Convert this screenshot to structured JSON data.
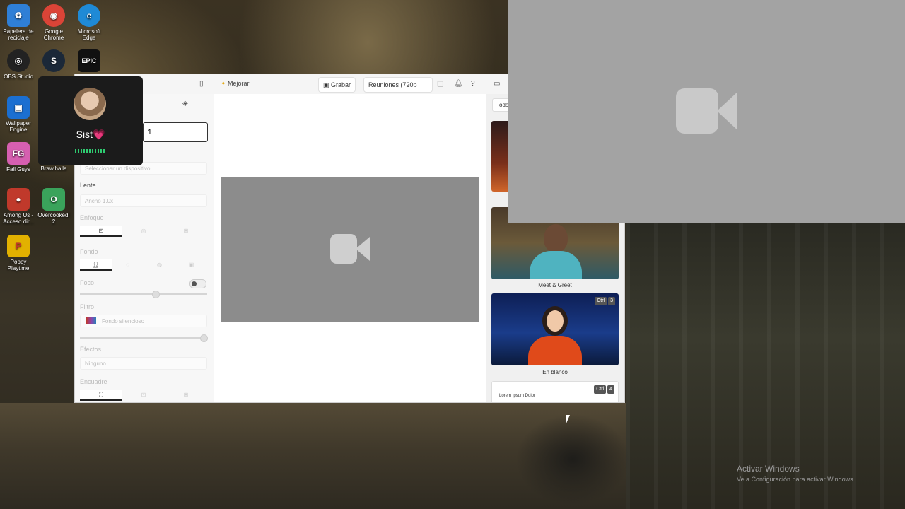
{
  "desktop": {
    "icons": [
      {
        "label": "Papelera de reciclaje",
        "glyph": "♻",
        "color": "#2f7fd6"
      },
      {
        "label": "Google Chrome",
        "glyph": "◉",
        "color": "#db4437"
      },
      {
        "label": "Microsoft Edge",
        "glyph": "e",
        "color": "#1f8ad6"
      },
      {
        "label": "OBS Studio",
        "glyph": "◎",
        "color": "#222222"
      },
      {
        "label": "",
        "glyph": "S",
        "color": "#1b2838"
      },
      {
        "label": "",
        "glyph": "EPIC",
        "color": "#111111"
      },
      {
        "label": "Wallpaper Engine",
        "glyph": "▣",
        "color": "#1b6fd1"
      },
      {
        "label": "Fall Guys",
        "glyph": "FG",
        "color": "#d65fb0"
      },
      {
        "label": "Brawlhalla",
        "glyph": "B",
        "color": "#4a6aa8"
      },
      {
        "label": "Among Us - Acceso dir...",
        "glyph": "●",
        "color": "#c0392b"
      },
      {
        "label": "Overcooked! 2",
        "glyph": "O",
        "color": "#3aa35b"
      },
      {
        "label": "Poppy Playtime",
        "glyph": "P",
        "color": "#e2b100"
      }
    ]
  },
  "profile": {
    "name": "Sist💗"
  },
  "app": {
    "toolbar": {
      "mejorar": "Mejorar",
      "grabar": "Grabar",
      "reuniones": "Reuniones (720p"
    },
    "left_panel": {
      "name_value": "1",
      "device_placeholder": "Seleccionar un dispositivo...",
      "lente_label": "Lente",
      "lente_value": "Ancho 1.0x",
      "enfoque_label": "Enfoque",
      "fondo_label": "Fondo",
      "foco_label": "Foco",
      "filtro_label": "Filtro",
      "filtro_value": "Fondo silencioso",
      "efectos_label": "Efectos",
      "efectos_value": "Ninguno",
      "encuadre_label": "Encuadre"
    },
    "right_panel": {
      "tab": "Todo",
      "scenes": [
        {
          "caption": "Meet & Greet",
          "shortcut_key": ""
        },
        {
          "caption": "En blanco",
          "shortcut_key": "3"
        },
        {
          "caption": "",
          "shortcut_key": "4",
          "text": "Lorem Ipsum Dolor"
        }
      ],
      "shortcut_modifier": "Ctrl"
    }
  },
  "watermark": {
    "line1": "Activar Windows",
    "line2": "Ve a Configuración para activar Windows."
  }
}
